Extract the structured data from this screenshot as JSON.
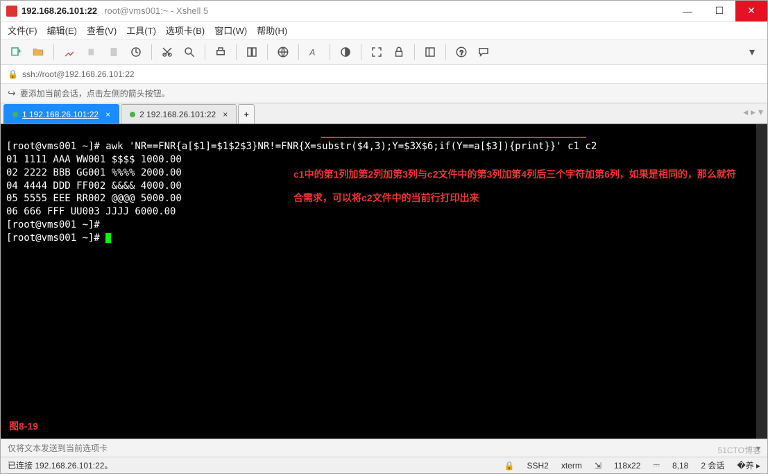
{
  "titlebar": {
    "main": "192.168.26.101:22",
    "sub": "root@vms001:~ - Xshell 5"
  },
  "menu": {
    "file": "文件(F)",
    "edit": "编辑(E)",
    "view": "查看(V)",
    "tools": "工具(T)",
    "tabs": "选项卡(B)",
    "window": "窗口(W)",
    "help": "帮助(H)"
  },
  "address": {
    "url": "ssh://root@192.168.26.101:22"
  },
  "hint": {
    "text": "要添加当前会话，点击左侧的箭头按钮。"
  },
  "tabs": {
    "t1": "1 192.168.26.101:22",
    "t2": "2 192.168.26.101:22",
    "add": "+"
  },
  "terminal": {
    "line1": "[root@vms001 ~]# awk 'NR==FNR{a[$1]=$1$2$3}NR!=FNR{X=substr($4,3);Y=$3X$6;if(Y==a[$3]){print}}' c1 c2",
    "line2": "01 1111 AAA WW001 $$$$ 1000.00",
    "line3": "02 2222 BBB GG001 %%%% 2000.00",
    "line4": "04 4444 DDD FF002 &&&& 4000.00",
    "line5": "05 5555 EEE RR002 @@@@ 5000.00",
    "line6": "06 666 FFF UU003 JJJJ 6000.00",
    "line7": "[root@vms001 ~]#",
    "line8": "[root@vms001 ~]# "
  },
  "annotation": {
    "text": "c1中的第1列加第2列加第3列与c2文件中的第3列加第4列后三个字符加第6列，如果是相同的，那么就符合需求，可以将c2文件中的当前行打印出来",
    "figure": "图8-19"
  },
  "sendbar": {
    "text": "仅将文本发送到当前选项卡"
  },
  "status": {
    "conn": "已连接 192.168.26.101:22。",
    "proto": "SSH2",
    "term": "xterm",
    "size": "118x22",
    "pos": "8,18",
    "sess": "2 会话"
  },
  "watermark": "51CTO博客"
}
